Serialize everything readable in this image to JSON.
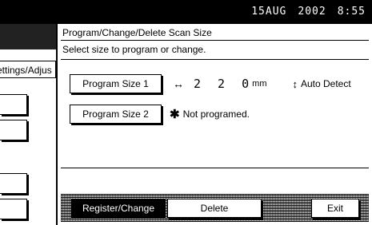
{
  "status": {
    "date": "15AUG",
    "year": "2002",
    "time": "8:55"
  },
  "left_panel": {
    "tab_label": "ettings/Adjus"
  },
  "dialog": {
    "title": "Program/Change/Delete Scan Size",
    "message": "Select size to program or change.",
    "program1": {
      "label": "Program Size 1",
      "arrow": "↔",
      "value": "2 2 0",
      "unit": "mm",
      "detect_symbol": "↕",
      "detect_text": "Auto Detect"
    },
    "program2": {
      "label": "Program Size 2",
      "star": "✱",
      "status_text": "Not programed."
    },
    "buttons": {
      "register": "Register/Change",
      "delete": "Delete",
      "exit": "Exit"
    }
  }
}
